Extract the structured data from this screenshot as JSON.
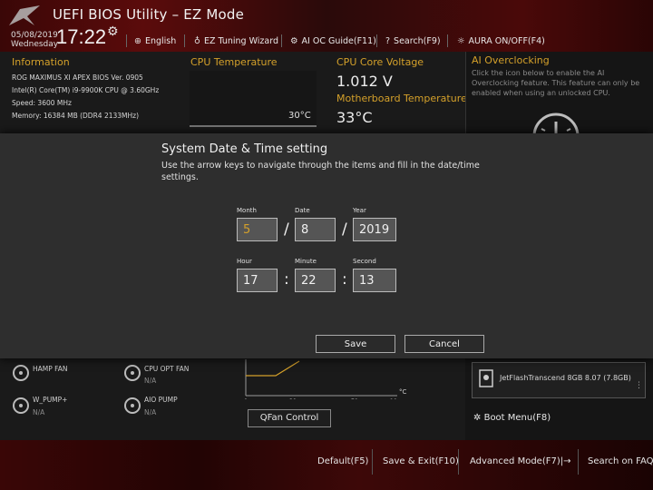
{
  "header": {
    "title": "UEFI BIOS Utility – EZ Mode",
    "date": "05/08/2019",
    "weekday": "Wednesday",
    "time": "17:22",
    "menu": [
      {
        "icon": "globe-icon",
        "label": "English"
      },
      {
        "icon": "bulb-icon",
        "label": "EZ Tuning Wizard"
      },
      {
        "icon": "ai-oc-icon",
        "label": "AI OC Guide(F11)"
      },
      {
        "icon": "search-icon",
        "label": "Search(F9)"
      },
      {
        "icon": "aura-icon",
        "label": "AURA ON/OFF(F4)"
      }
    ]
  },
  "information": {
    "title": "Information",
    "lines": [
      "ROG MAXIMUS XI APEX    BIOS Ver. 0905",
      "Intel(R) Core(TM) i9-9900K CPU @ 3.60GHz",
      "Speed: 3600 MHz",
      "Memory: 16384 MB (DDR4 2133MHz)"
    ]
  },
  "cpu_temp": {
    "title": "CPU Temperature",
    "value": "30°C"
  },
  "cpu_voltage": {
    "title": "CPU Core Voltage",
    "value": "1.012 V"
  },
  "mb_temp": {
    "title": "Motherboard Temperature",
    "value": "33°C"
  },
  "ai_oc": {
    "title": "AI Overclocking",
    "description": "Click the icon below to enable the AI Overclocking feature. This feature can only be enabled when using an unlocked CPU."
  },
  "dialog": {
    "title": "System Date & Time setting",
    "description": "Use the arrow keys to navigate through the items and fill in the date/time settings.",
    "date_labels": [
      "Month",
      "Date",
      "Year"
    ],
    "date_values": [
      "5",
      "8",
      "2019"
    ],
    "date_sep": "/",
    "time_labels": [
      "Hour",
      "Minute",
      "Second"
    ],
    "time_values": [
      "17",
      "22",
      "13"
    ],
    "time_sep": ":",
    "save_label": "Save",
    "cancel_label": "Cancel"
  },
  "fans": [
    {
      "name": "HAMP FAN",
      "value": ""
    },
    {
      "name": "CPU OPT FAN",
      "value": "N/A"
    },
    {
      "name": "W_PUMP+",
      "value": "N/A"
    },
    {
      "name": "AIO PUMP",
      "value": "N/A"
    }
  ],
  "qfan": {
    "x_ticks": [
      "0",
      "30",
      "70",
      "100"
    ],
    "unit": "°C",
    "button_label": "QFan Control"
  },
  "boot": {
    "device": "JetFlashTranscend 8GB 8.07 (7.8GB)",
    "boot_menu_label": "Boot Menu(F8)"
  },
  "footer": [
    {
      "label": "Default(F5)"
    },
    {
      "label": "Save & Exit(F10)"
    },
    {
      "label": "Advanced Mode(F7)|→"
    },
    {
      "label": "Search on FAQ"
    }
  ],
  "colors": {
    "accent": "#d4a02a",
    "brand_red": "#5b0b0b"
  }
}
